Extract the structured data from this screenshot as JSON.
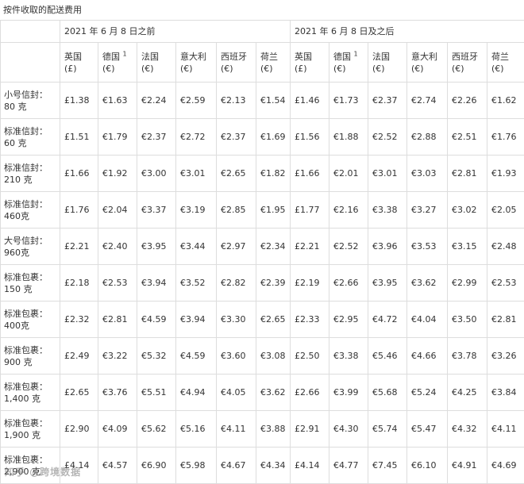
{
  "caption": "按件收取的配送费用",
  "headers": {
    "before": "2021 年 6 月 8 日之前",
    "after": "2021 年 6 月 8 日及之后"
  },
  "countries": [
    {
      "name": "英国",
      "sup": "",
      "unit": "(£)"
    },
    {
      "name": "德国",
      "sup": "1",
      "unit": "(€)"
    },
    {
      "name": "法国",
      "sup": "",
      "unit": "(€)"
    },
    {
      "name": "意大利",
      "sup": "",
      "unit": "(€)"
    },
    {
      "name": "西班牙",
      "sup": "",
      "unit": "(€)"
    },
    {
      "name": "荷兰",
      "sup": "",
      "unit": "(€)"
    }
  ],
  "rows": [
    {
      "line1": "小号信封：",
      "line2": "80 克",
      "before": [
        "£1.38",
        "€1.63",
        "€2.24",
        "€2.59",
        "€2.13",
        "€1.54"
      ],
      "after": [
        "£1.46",
        "€1.73",
        "€2.37",
        "€2.74",
        "€2.26",
        "€1.62"
      ]
    },
    {
      "line1": "标准信封：",
      "line2": "60 克",
      "before": [
        "£1.51",
        "€1.79",
        "€2.37",
        "€2.72",
        "€2.37",
        "€1.69"
      ],
      "after": [
        "£1.56",
        "€1.88",
        "€2.52",
        "€2.88",
        "€2.51",
        "€1.76"
      ]
    },
    {
      "line1": "标准信封：",
      "line2": "210 克",
      "before": [
        "£1.66",
        "€1.92",
        "€3.00",
        "€3.01",
        "€2.65",
        "€1.82"
      ],
      "after": [
        "£1.66",
        "€2.01",
        "€3.01",
        "€3.03",
        "€2.81",
        "€1.93"
      ]
    },
    {
      "line1": "标准信封：",
      "line2": "460克",
      "before": [
        "£1.76",
        "€2.04",
        "€3.37",
        "€3.19",
        "€2.85",
        "€1.95"
      ],
      "after": [
        "£1.77",
        "€2.16",
        "€3.38",
        "€3.27",
        "€3.02",
        "€2.05"
      ]
    },
    {
      "line1": "大号信封：",
      "line2": "960克",
      "before": [
        "£2.21",
        "€2.40",
        "€3.95",
        "€3.44",
        "€2.97",
        "€2.34"
      ],
      "after": [
        "£2.21",
        "€2.52",
        "€3.96",
        "€3.53",
        "€3.15",
        "€2.48"
      ]
    },
    {
      "line1": "标准包裹：",
      "line2": "150 克",
      "before": [
        "£2.18",
        "€2.53",
        "€3.94",
        "€3.52",
        "€2.82",
        "€2.39"
      ],
      "after": [
        "£2.19",
        "€2.66",
        "€3.95",
        "€3.62",
        "€2.99",
        "€2.53"
      ]
    },
    {
      "line1": "标准包裹：",
      "line2": "400克",
      "before": [
        "£2.32",
        "€2.81",
        "€4.59",
        "€3.94",
        "€3.30",
        "€2.65"
      ],
      "after": [
        "£2.33",
        "€2.95",
        "€4.72",
        "€4.04",
        "€3.50",
        "€2.81"
      ]
    },
    {
      "line1": "标准包裹：",
      "line2": "900 克",
      "before": [
        "£2.49",
        "€3.22",
        "€5.32",
        "€4.59",
        "€3.60",
        "€3.08"
      ],
      "after": [
        "£2.50",
        "€3.38",
        "€5.46",
        "€4.66",
        "€3.78",
        "€3.26"
      ]
    },
    {
      "line1": "标准包裹：",
      "line2": "1,400 克",
      "before": [
        "£2.65",
        "€3.76",
        "€5.51",
        "€4.94",
        "€4.05",
        "€3.62"
      ],
      "after": [
        "£2.66",
        "€3.99",
        "€5.68",
        "€5.24",
        "€4.25",
        "€3.84"
      ]
    },
    {
      "line1": "标准包裹：",
      "line2": "1,900 克",
      "before": [
        "£2.90",
        "€4.09",
        "€5.62",
        "€5.16",
        "€4.11",
        "€3.88"
      ],
      "after": [
        "£2.91",
        "€4.30",
        "€5.74",
        "€5.47",
        "€4.32",
        "€4.11"
      ]
    },
    {
      "line1": "标准包裹：",
      "line2": "2,900 克",
      "before": [
        "£4.14",
        "€4.57",
        "€6.90",
        "€5.98",
        "€4.67",
        "€4.34"
      ],
      "after": [
        "£4.14",
        "€4.77",
        "€7.45",
        "€6.10",
        "€4.91",
        "€4.69"
      ]
    }
  ],
  "watermark": "知乎 @跨境数据"
}
